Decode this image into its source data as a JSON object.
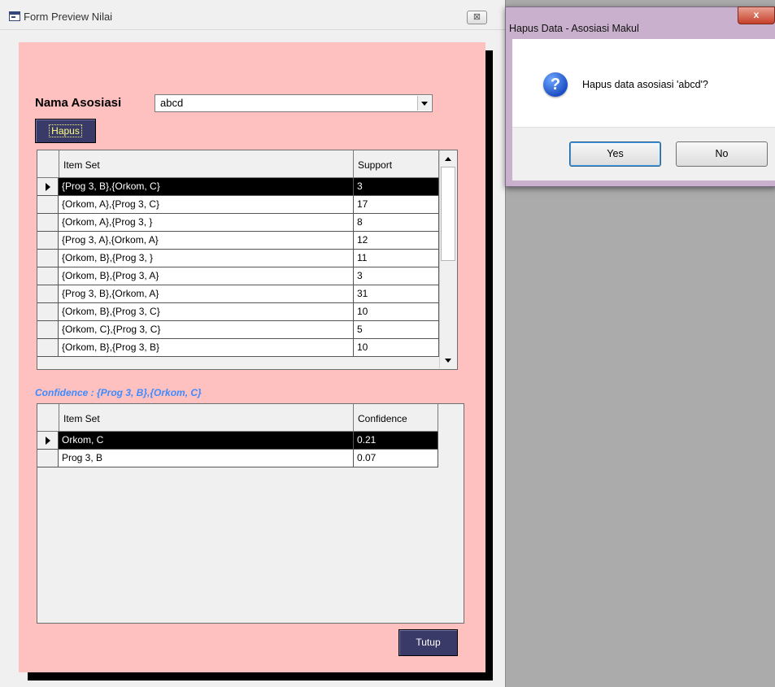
{
  "main_window": {
    "title": "Form Preview Nilai",
    "close_glyph": "⊠"
  },
  "form": {
    "nama_label": "Nama Asosiasi",
    "nama_value": "abcd",
    "hapus_label": "Hapus",
    "tutup_label": "Tutup",
    "confidence_title": "Confidence : {Prog 3, B},{Orkom, C}"
  },
  "itemset_grid": {
    "headers": [
      "Item Set",
      "Support"
    ],
    "rows": [
      [
        "{Prog 3, B},{Orkom, C}",
        "3"
      ],
      [
        "{Orkom, A},{Prog 3, C}",
        "17"
      ],
      [
        "{Orkom, A},{Prog 3, }",
        "8"
      ],
      [
        "{Prog 3, A},{Orkom, A}",
        "12"
      ],
      [
        "{Orkom, B},{Prog 3, }",
        "11"
      ],
      [
        "{Orkom, B},{Prog 3, A}",
        "3"
      ],
      [
        "{Prog 3, B},{Orkom, A}",
        "31"
      ],
      [
        "{Orkom, B},{Prog 3, C}",
        "10"
      ],
      [
        "{Orkom, C},{Prog 3, C}",
        "5"
      ],
      [
        "{Orkom, B},{Prog 3, B}",
        "10"
      ]
    ],
    "selected_row": 0
  },
  "confidence_grid": {
    "headers": [
      "Item Set",
      "Confidence"
    ],
    "rows": [
      [
        "Orkom, C",
        "0.21"
      ],
      [
        "Prog 3, B",
        "0.07"
      ]
    ],
    "selected_row": 0
  },
  "dialog": {
    "title": "Hapus Data - Asosiasi Makul",
    "close_glyph": "x",
    "icon": "question-icon",
    "message": "Hapus data asosiasi 'abcd'?",
    "yes_label": "Yes",
    "no_label": "No"
  },
  "colors": {
    "form_background": "#ffc0c0",
    "button_dark": "#3a3a68",
    "confidence_title": "#3d8cff",
    "selected_row": "#000000"
  }
}
